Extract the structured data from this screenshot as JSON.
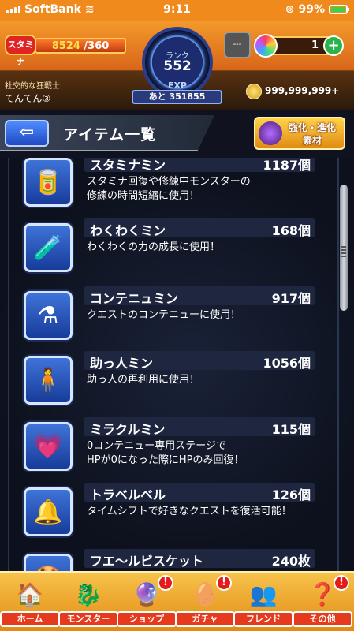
{
  "status_bar": {
    "carrier": "SoftBank",
    "time": "9:11",
    "battery": "99%"
  },
  "header": {
    "stamina_label": "スタミナ",
    "stamina_current": "8524",
    "stamina_max": "/360",
    "rank_label": "ランク",
    "rank": "552",
    "exp_label": "EXP",
    "exp_remaining": "あと 351855",
    "player_title": "社交的な狂戦士",
    "player_name": "てんてん③",
    "helmet_value": "---",
    "orb_count": "1",
    "coins": "999,999,999+"
  },
  "title_bar": {
    "title": "アイテム一覧",
    "evolve_button_line1": "強化・進化",
    "evolve_button_line2": "素材"
  },
  "items": [
    {
      "name": "スタミナミン",
      "count": "1187個",
      "desc1": "スタミナ回復や修練中モンスターの",
      "desc2": "修練の時間短縮に使用！",
      "icon": "can-icon"
    },
    {
      "name": "わくわくミン",
      "count": "168個",
      "desc1": "わくわくの力の成長に使用！",
      "desc2": "",
      "icon": "bottle-icon"
    },
    {
      "name": "コンテニュミン",
      "count": "917個",
      "desc1": "クエストのコンテニューに使用！",
      "desc2": "",
      "icon": "potion-icon"
    },
    {
      "name": "助っ人ミン",
      "count": "1056個",
      "desc1": "助っ人の再利用に使用！",
      "desc2": "",
      "icon": "helper-icon"
    },
    {
      "name": "ミラクルミン",
      "count": "115個",
      "desc1": "0コンテニュー専用ステージで",
      "desc2": "HPが0になった際にHPのみ回復！",
      "icon": "heart-potion-icon"
    },
    {
      "name": "トラベルベル",
      "count": "126個",
      "desc1": "タイムシフトで好きなクエストを復活可能！",
      "desc2": "",
      "icon": "bell-icon"
    },
    {
      "name": "フエ〜ルビスケット",
      "count": "240枚",
      "desc1": "",
      "desc2": "",
      "icon": "biscuit-icon"
    }
  ],
  "nav": [
    {
      "label": "ホーム",
      "icon": "home-icon",
      "badge": ""
    },
    {
      "label": "モンスター",
      "icon": "monster-icon",
      "badge": ""
    },
    {
      "label": "ショップ",
      "icon": "orb-shop-icon",
      "badge": "!"
    },
    {
      "label": "ガチャ",
      "icon": "gacha-icon",
      "badge": "!"
    },
    {
      "label": "フレンド",
      "icon": "friends-icon",
      "badge": ""
    },
    {
      "label": "その他",
      "icon": "other-icon",
      "badge": "!"
    }
  ],
  "colors": {
    "accent": "#f08a1c",
    "list_bg": "#0d111d",
    "item_icon": "#3f74d8",
    "nav_label": "#e53a1e"
  }
}
